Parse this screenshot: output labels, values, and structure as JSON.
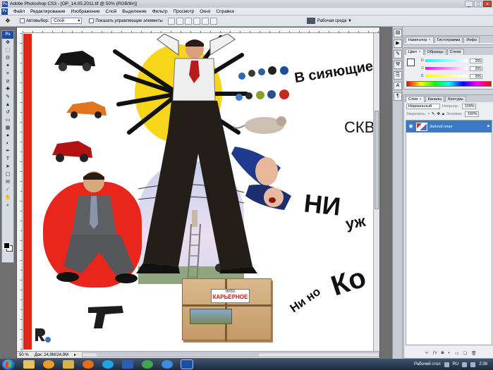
{
  "window": {
    "title": "Adobe Photoshop CS3 - [OP_14.05.2011.tif @ 50% (RGB/8#)]",
    "controls": [
      "_",
      "□",
      "×"
    ]
  },
  "menu": {
    "items": [
      "Файл",
      "Редактирование",
      "Изображение",
      "Слой",
      "Выделение",
      "Фильтр",
      "Просмотр",
      "Окно",
      "Справка"
    ]
  },
  "options": {
    "autoselect_label": "Автовыбор:",
    "autoselect_value": "Слой",
    "show_controls_label": "Показать управляющие элементы",
    "workspace_label": "Рабочая среда ▼"
  },
  "canvas": {
    "headline": "В сияющие Н",
    "skvo": "СКВС",
    "ni": "НИ",
    "uzh": "уж",
    "ko": "Ко",
    "nino": "Ни но",
    "box_small": "НИЗО",
    "box_big": "КАРЬЕРНОЕ"
  },
  "status": {
    "zoom": "50 %",
    "doc": "Док: 24,9M/24,9M"
  },
  "panels": {
    "nav_tabs": [
      "Навигатор",
      "Гистограмма",
      "Инфо"
    ],
    "color_tabs": [
      "Цвет",
      "Образцы",
      "Стили"
    ],
    "channels": [
      {
        "name": "R",
        "value": "255",
        "color": "#e22d2d"
      },
      {
        "name": "G",
        "value": "255",
        "color": "#2dbf45"
      },
      {
        "name": "B",
        "value": "255",
        "color": "#2d5ee2"
      }
    ],
    "layers_tabs": [
      "Слои",
      "Каналы",
      "Контуры"
    ],
    "blend_mode": "Нормальный",
    "opacity_label": "Непрозр.:",
    "opacity_value": "100%",
    "lock_label": "Закрепить:",
    "fill_label": "Заливка:",
    "fill_value": "100%",
    "layer_name": "Задний план"
  },
  "taskbar": {
    "tray_label": "Рабочий стол",
    "lang": "RU",
    "time": "2:38"
  }
}
